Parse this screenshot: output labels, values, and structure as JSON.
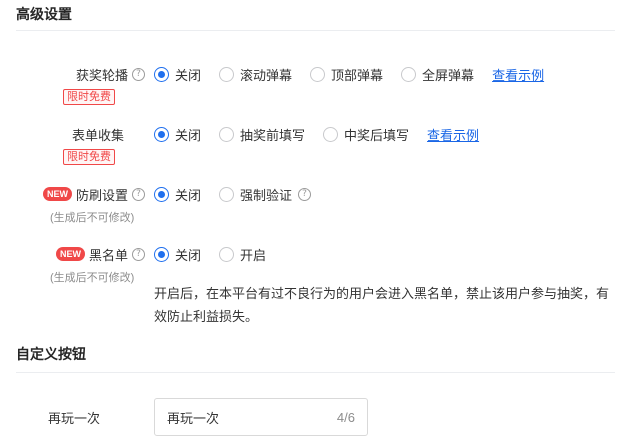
{
  "advanced": {
    "title": "高级设置",
    "rows": [
      {
        "label": "获奖轮播",
        "tag": "限时免费",
        "options": [
          "关闭",
          "滚动弹幕",
          "顶部弹幕",
          "全屏弹幕"
        ],
        "selected": "关闭",
        "link": "查看示例"
      },
      {
        "label": "表单收集",
        "tag": "限时免费",
        "options": [
          "关闭",
          "抽奖前填写",
          "中奖后填写"
        ],
        "selected": "关闭",
        "link": "查看示例"
      },
      {
        "badge": "NEW",
        "label": "防刷设置",
        "note": "(生成后不可修改)",
        "options": [
          "关闭",
          "强制验证"
        ],
        "selected": "关闭"
      },
      {
        "badge": "NEW",
        "label": "黑名单",
        "note": "(生成后不可修改)",
        "options": [
          "关闭",
          "开启"
        ],
        "selected": "关闭",
        "description": "开启后，在本平台有过不良行为的用户会进入黑名单，禁止该用户参与抽奖，有效防止利益损失。"
      }
    ]
  },
  "custom_button": {
    "title": "自定义按钮",
    "label": "再玩一次",
    "input_value": "再玩一次",
    "counter": "4/6"
  },
  "icons": {
    "help": "question-circle-icon",
    "radio_on": "radio-checked-icon",
    "radio_off": "radio-unchecked-icon"
  },
  "colors": {
    "accent": "#1f6fee",
    "tag_red": "#f04848",
    "link": "#1a66e6"
  }
}
